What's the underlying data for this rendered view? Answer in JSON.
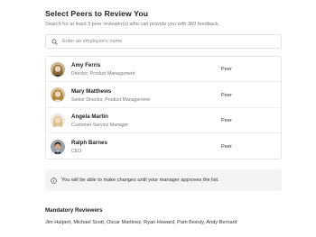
{
  "header": {
    "title": "Select Peers to Review You",
    "subtitle": "Search for at least 3 peer reviewer(s) who can provide you with 360 feedback."
  },
  "search": {
    "placeholder": "Enter an employee's name",
    "value": "",
    "icon": "search-icon"
  },
  "peers": [
    {
      "name": "Amy Ferris",
      "role": "Director, Product Management",
      "type": "Peer"
    },
    {
      "name": "Mary Matthews",
      "role": "Senior Director, Product Management",
      "type": "Peer"
    },
    {
      "name": "Angela Martin",
      "role": "Customer Service Manager",
      "type": "Peer"
    },
    {
      "name": "Ralph Barnes",
      "role": "CEO",
      "type": "Peer"
    }
  ],
  "notice": {
    "icon": "info-icon",
    "text": "You will be able to make changes until your manager approves the list."
  },
  "mandatory": {
    "title": "Mandatory Reviewers",
    "list": "Jim Halpert, Michael Scott, Oscar Martinez, Ryan Howard, Pam Beesly, Andy Bernard"
  },
  "colors": {
    "notice_bg": "#f4f4f4",
    "border": "#e6e6e6",
    "muted_text": "#7a7a7a"
  }
}
